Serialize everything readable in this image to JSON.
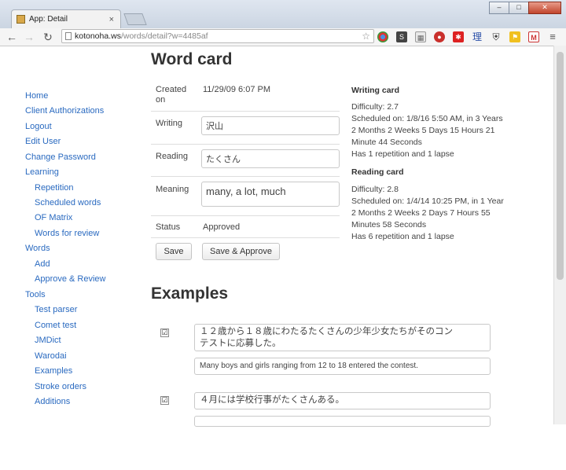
{
  "browser": {
    "tab_title": "App: Detail",
    "tab_close": "×",
    "url_host": "kotonoha.ws",
    "url_path": "/words/detail?w=4485af",
    "extension_icons": [
      "chrome-icon",
      "s-icon",
      "grid-icon",
      "record-icon",
      "star-badge-icon",
      "kanji-icon",
      "shield-icon",
      "flag-icon",
      "gmail-icon",
      "menu-icon"
    ],
    "ext_kanji_label": "理"
  },
  "sidebar": {
    "items": [
      {
        "label": "Home",
        "level": 1
      },
      {
        "label": "Client Authorizations",
        "level": 1
      },
      {
        "label": "Logout",
        "level": 1
      },
      {
        "label": "Edit User",
        "level": 1
      },
      {
        "label": "Change Password",
        "level": 1
      },
      {
        "label": "Learning",
        "level": 1
      },
      {
        "label": "Repetition",
        "level": 2
      },
      {
        "label": "Scheduled words",
        "level": 2
      },
      {
        "label": "OF Matrix",
        "level": 2
      },
      {
        "label": "Words for review",
        "level": 2
      },
      {
        "label": "Words",
        "level": 1
      },
      {
        "label": "Add",
        "level": 2
      },
      {
        "label": "Approve & Review",
        "level": 2
      },
      {
        "label": "Tools",
        "level": 1
      },
      {
        "label": "Test parser",
        "level": 2
      },
      {
        "label": "Comet test",
        "level": 2
      },
      {
        "label": "JMDict",
        "level": 2
      },
      {
        "label": "Warodai",
        "level": 2
      },
      {
        "label": "Examples",
        "level": 2
      },
      {
        "label": "Stroke orders",
        "level": 2
      },
      {
        "label": "Additions",
        "level": 2
      }
    ]
  },
  "word_card": {
    "title": "Word card",
    "created_label_line1": "Created",
    "created_label_line2": "on",
    "created_value": "11/29/09 6:07 PM",
    "writing_label": "Writing",
    "writing_value": "沢山",
    "reading_label": "Reading",
    "reading_value": "たくさん",
    "meaning_label": "Meaning",
    "meaning_value": "many, a lot, much",
    "status_label": "Status",
    "status_value": "Approved",
    "save_label": "Save",
    "save_approve_label": "Save & Approve"
  },
  "writing_card": {
    "title": "Writing card",
    "lines": [
      "Difficulty: 2.7",
      "Scheduled on: 1/8/16 5:50 AM, in 3 Years",
      "2 Months 2 Weeks 5 Days 15 Hours 21",
      "Minute 44 Seconds",
      "Has 1 repetition and 1 lapse"
    ]
  },
  "reading_card": {
    "title": "Reading card",
    "lines": [
      "Difficulty: 2.8",
      "Scheduled on: 1/4/14 10:25 PM, in 1 Year",
      "2 Months 2 Weeks 2 Days 7 Hours 55",
      "Minutes 58 Seconds",
      "Has 6 repetition and 1 lapse"
    ]
  },
  "examples": {
    "title": "Examples",
    "items": [
      {
        "checked": "☑",
        "japanese_line1": "１２歳から１８歳にわたるたくさんの少年少女たちがそのコン",
        "japanese_line2": "テストに応募した。",
        "english": "Many boys and girls ranging from 12 to 18 entered the contest."
      },
      {
        "checked": "☑",
        "japanese_line1": "４月には学校行事がたくさんある。",
        "japanese_line2": "",
        "english": ""
      }
    ]
  }
}
